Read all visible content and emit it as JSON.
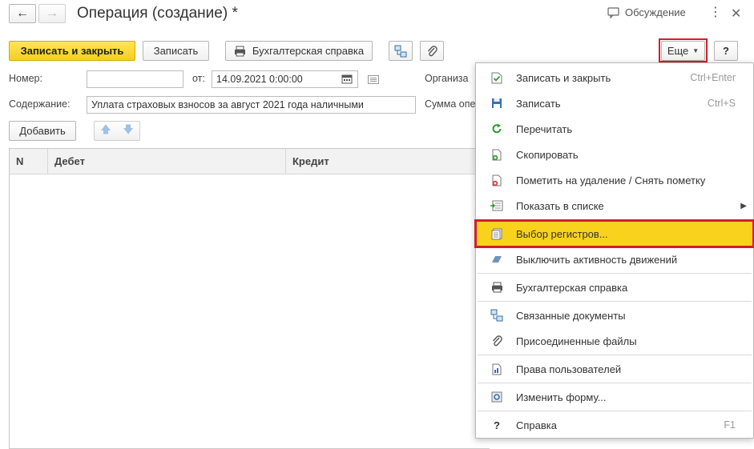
{
  "window": {
    "title": "Операция (создание) *",
    "discussion_label": "Обсуждение"
  },
  "toolbar": {
    "save_close_label": "Записать и закрыть",
    "save_label": "Записать",
    "accounting_ref_label": "Бухгалтерская справка",
    "more_label": "Еще",
    "help_label": "?"
  },
  "form": {
    "number_label": "Номер:",
    "number_value": "",
    "date_label": "от:",
    "date_value": "14.09.2021  0:00:00",
    "org_label": "Организа",
    "content_label": "Содержание:",
    "content_value": "Уплата страховых взносов за август 2021 года наличными",
    "sum_label": "Сумма опе"
  },
  "table_toolbar": {
    "add_label": "Добавить"
  },
  "table": {
    "columns": [
      "N",
      "Дебет",
      "Кредит"
    ],
    "rows": []
  },
  "menu": {
    "items": [
      {
        "label": "Записать и закрыть",
        "shortcut": "Ctrl+Enter",
        "icon": "save-close-icon"
      },
      {
        "label": "Записать",
        "shortcut": "Ctrl+S",
        "icon": "floppy-icon"
      },
      {
        "label": "Перечитать",
        "shortcut": "",
        "icon": "refresh-icon"
      },
      {
        "label": "Скопировать",
        "shortcut": "",
        "icon": "copy-icon"
      },
      {
        "label": "Пометить на удаление / Снять пометку",
        "shortcut": "",
        "icon": "delete-mark-icon"
      },
      {
        "label": "Показать в списке",
        "shortcut": "",
        "icon": "show-in-list-icon",
        "submenu": true
      },
      {
        "label": "Выбор регистров...",
        "shortcut": "",
        "icon": "registers-icon",
        "selected": true
      },
      {
        "label": "Выключить активность движений",
        "shortcut": "",
        "icon": "deactivate-icon"
      },
      {
        "label": "Бухгалтерская справка",
        "shortcut": "",
        "icon": "printer-icon"
      },
      {
        "label": "Связанные документы",
        "shortcut": "",
        "icon": "linked-docs-icon"
      },
      {
        "label": "Присоединенные файлы",
        "shortcut": "",
        "icon": "paperclip-icon"
      },
      {
        "label": "Права пользователей",
        "shortcut": "",
        "icon": "user-rights-icon"
      },
      {
        "label": "Изменить форму...",
        "shortcut": "",
        "icon": "form-settings-icon"
      },
      {
        "label": "Справка",
        "shortcut": "F1",
        "icon": "help-icon"
      }
    ]
  },
  "colors": {
    "primary_button": "#f5cf1a",
    "selected_item": "#f9d21e",
    "highlight_frame": "#d21e2a"
  }
}
